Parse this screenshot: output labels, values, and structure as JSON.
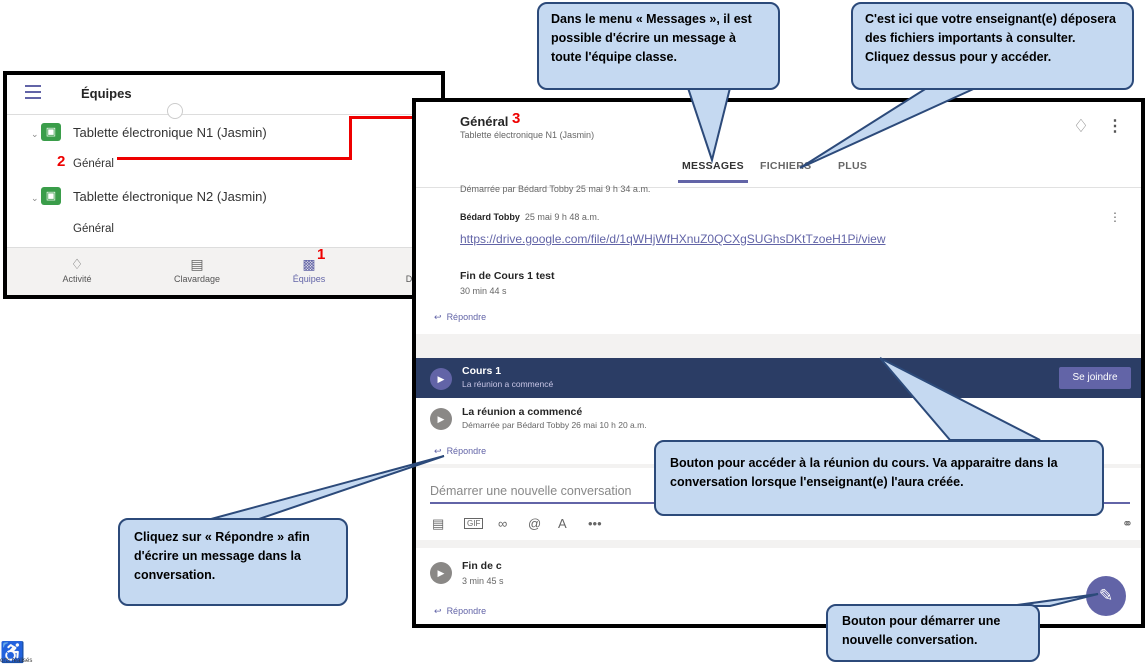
{
  "left_panel": {
    "title": "Équipes",
    "teams": [
      {
        "name": "Tablette électronique N1 (Jasmin)",
        "channel": "Général",
        "icon": "gamepad-icon"
      },
      {
        "name": "Tablette électronique N2 (Jasmin)",
        "channel": "Général",
        "icon": "gamepad-icon"
      }
    ],
    "nav": [
      {
        "label": "Activité",
        "icon": "bell-icon"
      },
      {
        "label": "Clavardage",
        "icon": "chat-icon"
      },
      {
        "label": "Équipes",
        "icon": "teams-icon"
      },
      {
        "label": "Devoirs",
        "icon": "clipboard-icon"
      }
    ],
    "step_numbers": {
      "channel": "2",
      "teams_nav": "1"
    }
  },
  "main_panel": {
    "title": "Général",
    "title_step": "3",
    "subtitle": "Tablette électronique N1 (Jasmin)",
    "tabs": [
      "MESSAGES",
      "FICHIERS",
      "PLUS"
    ],
    "active_tab": "MESSAGES",
    "partial_text": "Démarrée par Bédard Tobby   25 mai 9 h 34 a.m.",
    "post": {
      "author": "Bédard Tobby",
      "time": "25 mai 9 h 48 a.m.",
      "link": "https://drive.google.com/file/d/1qWHjWfHXnuZ0QCXgSUGhsDKtTzoeH1Pi/view",
      "meeting_title": "Fin de Cours 1 test",
      "meeting_duration": "30 min 44 s",
      "reply": "Répondre"
    },
    "meeting": {
      "title": "Cours 1",
      "status": "La réunion a commencé",
      "join_label": "Se joindre",
      "sub_title": "La réunion a commencé",
      "sub_meta": "Démarrée par Bédard Tobby   26 mai 10 h 20 a.m.",
      "reply": "Répondre"
    },
    "compose": {
      "placeholder": "Démarrer une nouvelle conversation",
      "tools": [
        "image-icon",
        "gif-icon",
        "attach-icon",
        "mention-icon",
        "format-icon",
        "more-icon"
      ]
    },
    "last_post": {
      "title": "Fin de c",
      "duration": "3 min 45 s",
      "reply": "Répondre"
    }
  },
  "callouts": {
    "messages": "Dans le menu « Messages », il est possible d'écrire un message à toute l'équipe classe.",
    "files": "C'est ici que votre enseignant(e) déposera des fichiers importants à consulter. Cliquez dessus pour y accéder.",
    "join": "Bouton pour accéder à la réunion du cours. Va apparaitre dans la conversation lorsque l'enseignant(e) l'aura créée.",
    "reply": "Cliquez sur « Répondre » afin d'écrire un message dans la conversation.",
    "new_conv": "Bouton pour démarrer une nouvelle conversation."
  },
  "footer": {
    "text": "orts réalisés"
  },
  "colors": {
    "accent": "#6264a7",
    "dark_bar": "#2b3d65",
    "callout_fill": "#c5d9f1",
    "callout_border": "#2c4a7a",
    "step_red": "#e00000"
  }
}
